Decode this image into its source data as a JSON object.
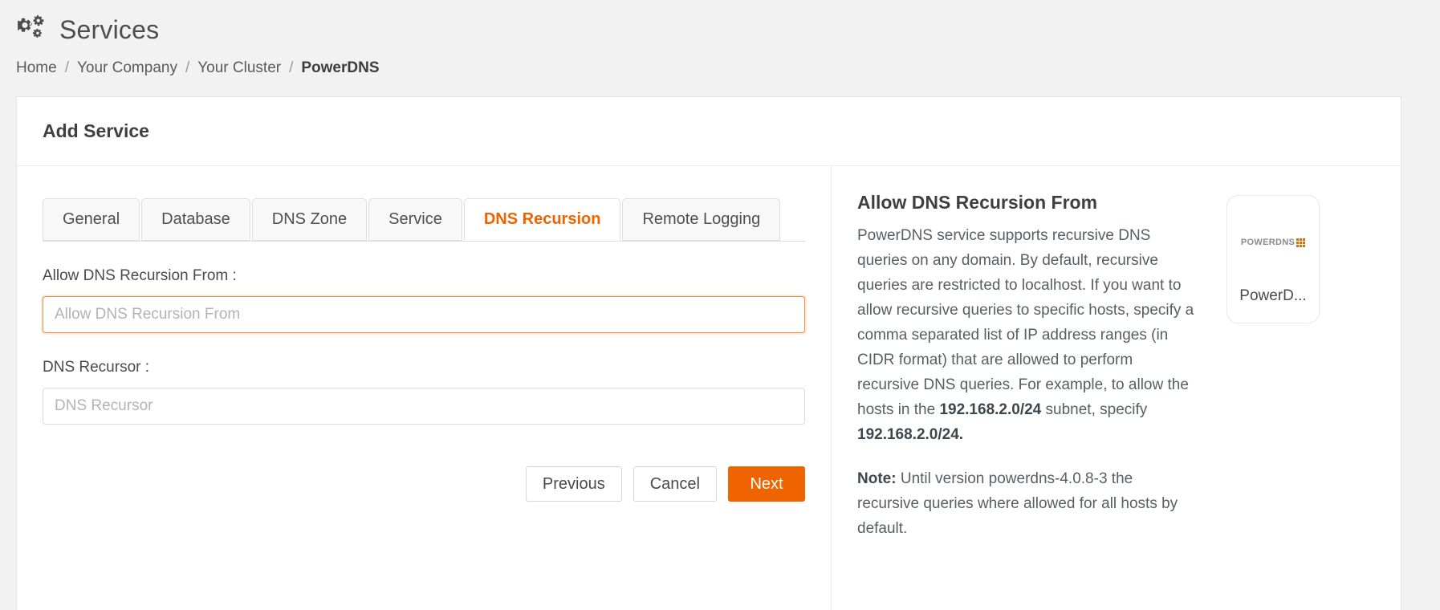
{
  "header": {
    "icon": "cogs-icon",
    "title": "Services"
  },
  "breadcrumb": {
    "items": [
      {
        "label": "Home",
        "active": false
      },
      {
        "label": "Your Company",
        "active": false
      },
      {
        "label": "Your Cluster",
        "active": false
      },
      {
        "label": "PowerDNS",
        "active": true
      }
    ],
    "separator": "/"
  },
  "card": {
    "title": "Add Service"
  },
  "tabs": [
    {
      "label": "General",
      "active": false
    },
    {
      "label": "Database",
      "active": false
    },
    {
      "label": "DNS Zone",
      "active": false
    },
    {
      "label": "Service",
      "active": false
    },
    {
      "label": "DNS Recursion",
      "active": true
    },
    {
      "label": "Remote Logging",
      "active": false
    }
  ],
  "form": {
    "fields": [
      {
        "label": "Allow DNS Recursion From :",
        "placeholder": "Allow DNS Recursion From",
        "value": "",
        "focused": true
      },
      {
        "label": "DNS Recursor :",
        "placeholder": "DNS Recursor",
        "value": "",
        "focused": false
      }
    ],
    "buttons": {
      "previous": "Previous",
      "cancel": "Cancel",
      "next": "Next"
    }
  },
  "help": {
    "title": "Allow DNS Recursion From",
    "body_part_1": "PowerDNS service supports recursive DNS queries on any domain. By default, recursive queries are restricted to localhost. If you want to allow recursive queries to specific hosts, specify a comma separated list of IP address ranges (in CIDR format) that are allowed to perform recursive DNS queries. For example, to allow the hosts in the ",
    "cidr_1": "192.168.2.0/24",
    "body_part_2": " subnet, specify ",
    "cidr_2": "192.168.2.0/24.",
    "note_label": "Note:",
    "note_text": " Until version powerdns-4.0.8-3 the recursive queries where allowed for all hosts by default."
  },
  "logo_tile": {
    "logo_word": "POWERDNS",
    "caption": "PowerD..."
  },
  "colors": {
    "accent": "#ef6400",
    "page_background": "#f2f2f2",
    "card_background": "#ffffff",
    "text": "#4a4a4a"
  }
}
